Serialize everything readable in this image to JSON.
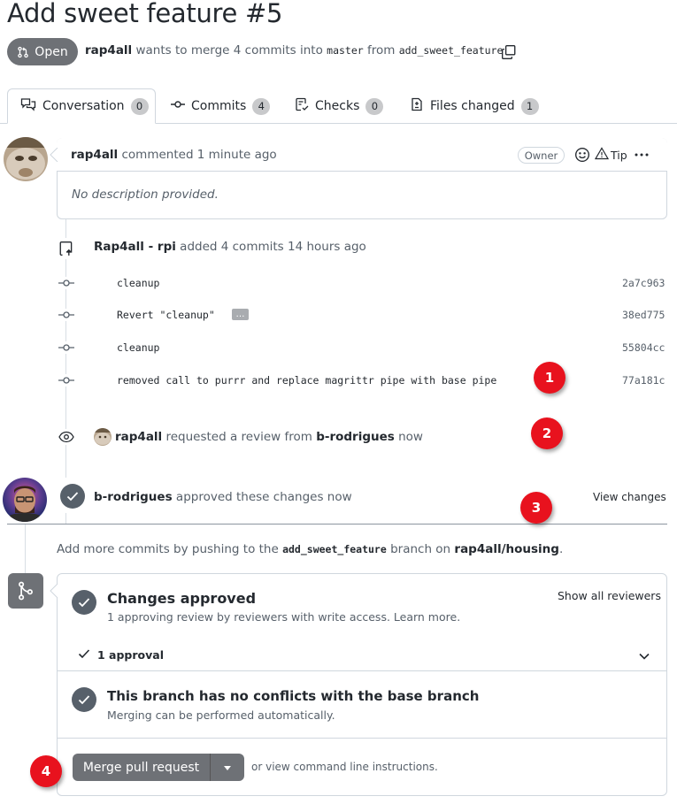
{
  "pr": {
    "title": "Add sweet feature #5",
    "state": "Open",
    "author": "rap4all",
    "meta_text": " wants to merge 4 commits into ",
    "base_branch": "master",
    "from_text": " from ",
    "head_branch": "add_sweet_feature"
  },
  "tabs": [
    {
      "label": "Conversation",
      "count": "0"
    },
    {
      "label": "Commits",
      "count": "4"
    },
    {
      "label": "Checks",
      "count": "0"
    },
    {
      "label": "Files changed",
      "count": "1"
    }
  ],
  "comment": {
    "author": "rap4all",
    "action": " commented 1 minute ago",
    "badge": "Owner",
    "tip_label": "Tip",
    "body": "No description provided."
  },
  "commits_event": {
    "actor": "Rap4all - rpi",
    "text": " added 4 commits 14 hours ago",
    "items": [
      {
        "message": "cleanup",
        "sha": "2a7c963",
        "ellipsis": false
      },
      {
        "message": "Revert \"cleanup\"",
        "sha": "38ed775",
        "ellipsis": true,
        "ellipsis_label": "…"
      },
      {
        "message": "cleanup",
        "sha": "55804cc",
        "ellipsis": false
      },
      {
        "message": "removed call to purrr and replace magrittr pipe with base pipe",
        "sha": "77a181c",
        "ellipsis": false
      }
    ]
  },
  "review_request": {
    "actor": "rap4all",
    "text": " requested a review from ",
    "reviewer": "b-rodrigues",
    "time": " now"
  },
  "approval": {
    "actor": "b-rodrigues",
    "text": " approved these changes now",
    "view_changes": "View changes"
  },
  "hint": {
    "prefix": "Add more commits by pushing to the ",
    "branch": "add_sweet_feature",
    "middle": " branch on ",
    "repo": "rap4all/housing",
    "suffix": "."
  },
  "merge_box": {
    "approved_title": "Changes approved",
    "approved_sub": "1 approving review by reviewers with write access. Learn more.",
    "show_reviewers": "Show all reviewers",
    "approvals": "1 approval",
    "conflicts_title": "This branch has no conflicts with the base branch",
    "conflicts_sub": "Merging can be performed automatically.",
    "merge_button": "Merge pull request",
    "cli_text": "or view command line instructions."
  },
  "markers": [
    "1",
    "2",
    "3",
    "4"
  ],
  "colors": {
    "marker": "#e8121e",
    "button": "#6e7176"
  },
  "icons": [
    "pull-request-icon",
    "copy-icon",
    "conversation-icon",
    "commit-icon",
    "checklist-icon",
    "diff-icon",
    "smiley-icon",
    "alert-icon",
    "kebab-icon",
    "repo-push-icon",
    "eye-icon",
    "check-icon",
    "git-merge-icon",
    "chevron-down-icon",
    "triangle-down-icon"
  ]
}
